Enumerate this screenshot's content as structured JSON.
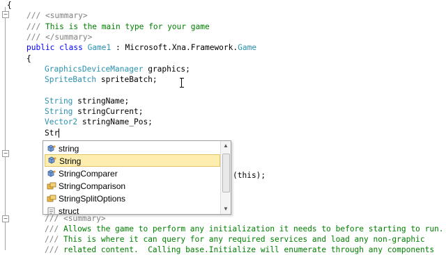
{
  "editor": {
    "lines": [
      {
        "text": "{",
        "indent": 0,
        "kind": "plain"
      },
      {
        "segments": [
          {
            "t": "/// ",
            "k": "doc"
          },
          {
            "t": "<summary>",
            "k": "doc"
          }
        ]
      },
      {
        "segments": [
          {
            "t": "/// ",
            "k": "doc"
          },
          {
            "t": "This is the main type for your game",
            "k": "comment"
          }
        ]
      },
      {
        "segments": [
          {
            "t": "/// ",
            "k": "doc"
          },
          {
            "t": "</summary>",
            "k": "doc"
          }
        ]
      },
      {
        "segments": [
          {
            "t": "public ",
            "k": "kw"
          },
          {
            "t": "class ",
            "k": "kw"
          },
          {
            "t": "Game1 ",
            "k": "type"
          },
          {
            "t": ": Microsoft.Xna.Framework.",
            "k": "plain"
          },
          {
            "t": "Game",
            "k": "type"
          }
        ]
      },
      {
        "segments": [
          {
            "t": "{",
            "k": "plain"
          }
        ]
      },
      {
        "segments": [
          {
            "t": "GraphicsDeviceManager ",
            "k": "type"
          },
          {
            "t": "graphics;",
            "k": "plain"
          }
        ]
      },
      {
        "segments": [
          {
            "t": "SpriteBatch ",
            "k": "type"
          },
          {
            "t": "spriteBatch;",
            "k": "plain"
          }
        ]
      },
      {
        "segments": [
          {
            "t": "String ",
            "k": "type"
          },
          {
            "t": "stringName;",
            "k": "plain"
          }
        ]
      },
      {
        "segments": [
          {
            "t": "String ",
            "k": "type"
          },
          {
            "t": "stringCurrent;",
            "k": "plain"
          }
        ]
      },
      {
        "segments": [
          {
            "t": "Vector2 ",
            "k": "type"
          },
          {
            "t": "stringName_Pos;",
            "k": "plain"
          }
        ]
      },
      {
        "segments": [
          {
            "t": "Str",
            "k": "plain"
          }
        ]
      },
      {
        "segments": [
          {
            "t": "(this);",
            "k": "plain"
          }
        ]
      },
      {
        "segments": [
          {
            "t": "/// ",
            "k": "doc"
          },
          {
            "t": "<summary>",
            "k": "doc"
          }
        ]
      },
      {
        "segments": [
          {
            "t": "/// ",
            "k": "doc"
          },
          {
            "t": "Allows the game to perform any initialization it needs to before starting to run.",
            "k": "comment"
          }
        ]
      },
      {
        "segments": [
          {
            "t": "/// ",
            "k": "doc"
          },
          {
            "t": "This is where it can query for any required services and load any non-graphic",
            "k": "comment"
          }
        ]
      },
      {
        "segments": [
          {
            "t": "/// ",
            "k": "doc"
          },
          {
            "t": "related content.  Calling base.Initialize will enumerate through any components",
            "k": "comment"
          }
        ]
      }
    ]
  },
  "intellisense": {
    "items": [
      {
        "label": "string",
        "icon": "class-icon",
        "selected": false
      },
      {
        "label": "String",
        "icon": "class-icon",
        "selected": true
      },
      {
        "label": "StringComparer",
        "icon": "class-icon",
        "selected": false
      },
      {
        "label": "StringComparison",
        "icon": "enum-icon",
        "selected": false
      },
      {
        "label": "StringSplitOptions",
        "icon": "enum-icon",
        "selected": false
      },
      {
        "label": "struct",
        "icon": "keyword-icon",
        "selected": false
      }
    ],
    "scroll_up_icon": "scroll-up-arrow-icon",
    "scroll_down_icon": "scroll-down-arrow-icon"
  },
  "colors": {
    "comment": "#008000",
    "doc": "#808080",
    "keyword": "#0000ff",
    "type": "#2b91af",
    "selection_bg": "#fdeeb0"
  }
}
